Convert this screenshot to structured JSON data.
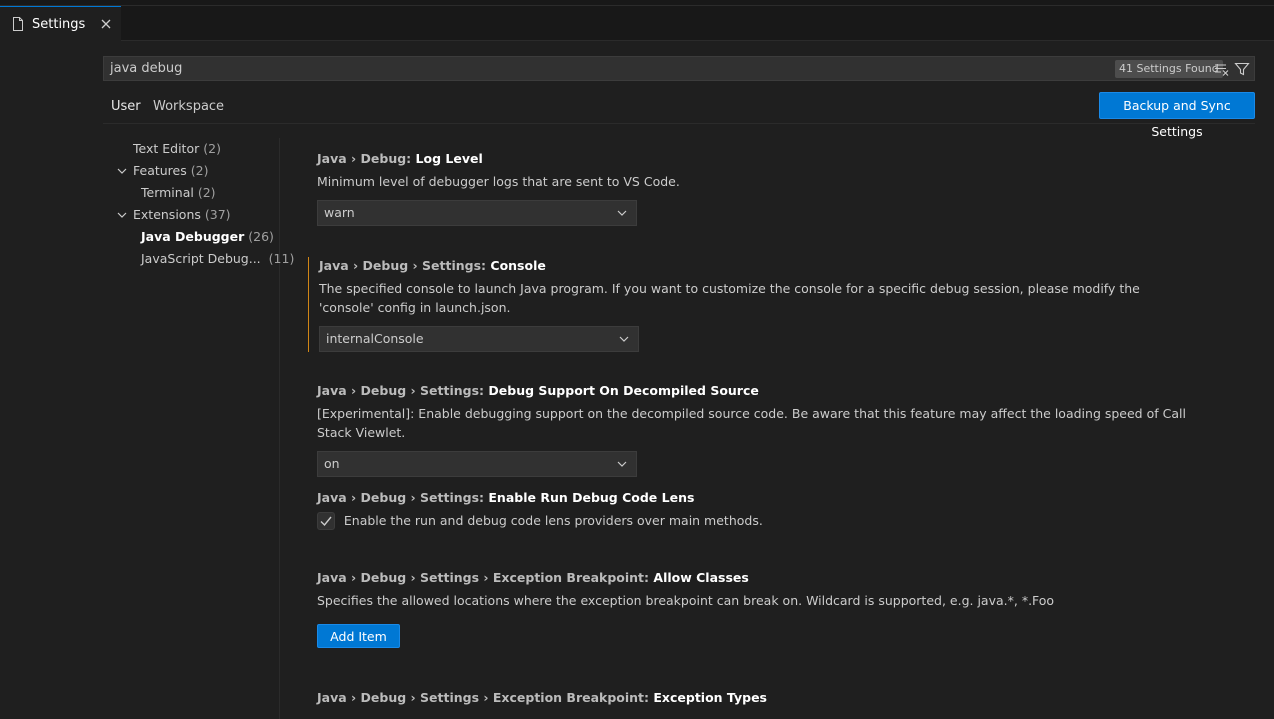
{
  "tab": {
    "label": "Settings",
    "icon": "file-icon",
    "close_icon": "close-icon"
  },
  "search": {
    "value": "java debug",
    "result_count": "41 Settings Found",
    "clear_icon": "clear-filter-icon",
    "filter_icon": "filter-icon"
  },
  "scopes": [
    {
      "label": "User",
      "active": true
    },
    {
      "label": "Workspace",
      "active": false
    }
  ],
  "sync_button": "Backup and Sync Settings",
  "toc": [
    {
      "name": "Text Editor",
      "count": "(2)",
      "indent": 1,
      "chevron": false
    },
    {
      "name": "Features",
      "count": "(2)",
      "indent": 0,
      "chevron": true
    },
    {
      "name": "Terminal",
      "count": "(2)",
      "indent": 2,
      "chevron": false
    },
    {
      "name": "Extensions",
      "count": "(37)",
      "indent": 0,
      "chevron": true
    },
    {
      "name": "Java Debugger",
      "count": "(26)",
      "indent": 2,
      "chevron": false,
      "active": true
    },
    {
      "name": "JavaScript Debug...",
      "count": "(11)",
      "indent": 2,
      "chevron": false
    }
  ],
  "settings": [
    {
      "category": "Java › Debug: ",
      "key": "Log Level",
      "description": "Minimum level of debugger logs that are sent to VS Code.",
      "control": "select",
      "value": "warn",
      "modified": false
    },
    {
      "category": "Java › Debug › Settings: ",
      "key": "Console",
      "description": "The specified console to launch Java program. If you want to customize the console for a specific debug session, please modify the 'console' config in launch.json.",
      "control": "select",
      "value": "internalConsole",
      "modified": true
    },
    {
      "category": "Java › Debug › Settings: ",
      "key": "Debug Support On Decompiled Source",
      "description": "[Experimental]: Enable debugging support on the decompiled source code. Be aware that this feature may affect the loading speed of Call Stack Viewlet.",
      "control": "select",
      "value": "on",
      "modified": false
    },
    {
      "category": "Java › Debug › Settings: ",
      "key": "Enable Run Debug Code Lens",
      "description": "Enable the run and debug code lens providers over main methods.",
      "control": "checkbox",
      "checked": true,
      "modified": false
    },
    {
      "category": "Java › Debug › Settings › Exception Breakpoint: ",
      "key": "Allow Classes",
      "description": "Specifies the allowed locations where the exception breakpoint can break on. Wildcard is supported, e.g. java.*, *.Foo",
      "control": "button",
      "button_label": "Add Item",
      "modified": false
    },
    {
      "category": "Java › Debug › Settings › Exception Breakpoint: ",
      "key": "Exception Types",
      "description": "",
      "control": "none",
      "modified": false
    }
  ],
  "colors": {
    "accent": "#0078d4",
    "modified_bar": "#d18616",
    "background": "#1f1f1f"
  }
}
